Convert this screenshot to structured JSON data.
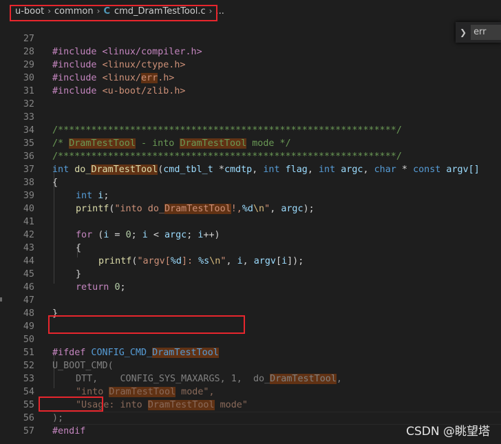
{
  "breadcrumb": {
    "items": [
      "u-boot",
      "common",
      "cmd_DramTestTool.c",
      "..."
    ],
    "file_icon": "C"
  },
  "find_widget": {
    "value": "err"
  },
  "watermark": "CSDN @眺望塔",
  "editor": {
    "line_numbers": [
      "27",
      "28",
      "29",
      "30",
      "31",
      "32",
      "33",
      "34",
      "35",
      "36",
      "37",
      "38",
      "39",
      "40",
      "41",
      "42",
      "43",
      "44",
      "45",
      "46",
      "47",
      "48",
      "49",
      "50",
      "51",
      "52",
      "53",
      "54",
      "55",
      "56",
      "57"
    ],
    "lines": {
      "l27": "#include <linux/compiler.h>",
      "l28a": "#include ",
      "l28b": "<linux/ctype.h>",
      "l29a": "#include ",
      "l29b": "<linux/",
      "l29c": "err",
      "l29d": ".h>",
      "l30a": "#include ",
      "l30b": "<u-boot/zlib.h>",
      "l33": "/*************************************************************/",
      "l34a": "/* ",
      "l34b": "DramTestTool",
      "l34c": " - into ",
      "l34d": "DramTestTool",
      "l34e": " mode */",
      "l35": "/*************************************************************/",
      "l36a": "int",
      "l36b": " do_",
      "l36c": "DramTestTool",
      "l36d": "(",
      "l36e": "cmd_tbl_t",
      "l36f": " *",
      "l36g": "cmdtp",
      "l36h": ", ",
      "l36i": "int",
      "l36j": " flag",
      "l36k": ", ",
      "l36l": "int",
      "l36m": " argc",
      "l36n": ", ",
      "l36o": "char",
      "l36p": " * ",
      "l36q": "const",
      "l36r": " argv[]",
      "l37": "{",
      "l38a": "int",
      "l38b": " i",
      "l38c": ";",
      "l39a": "printf",
      "l39b": "(",
      "l39c": "\"into do_",
      "l39d": "DramTestTool",
      "l39e": "!,",
      "l39f": "%d",
      "l39g": "\\n",
      "l39h": "\"",
      "l39i": ", ",
      "l39j": "argc",
      "l39k": ");",
      "l41a": "for",
      "l41b": " (",
      "l41c": "i",
      "l41d": " = ",
      "l41e": "0",
      "l41f": "; ",
      "l41g": "i",
      "l41h": " < ",
      "l41i": "argc",
      "l41j": "; ",
      "l41k": "i",
      "l41l": "++)",
      "l42": "{",
      "l43a": "printf",
      "l43b": "(",
      "l43c": "\"argv[",
      "l43d": "%d",
      "l43e": "]: ",
      "l43f": "%s",
      "l43g": "\\n",
      "l43h": "\"",
      "l43i": ", ",
      "l43j": "i",
      "l43k": ", ",
      "l43l": "argv",
      "l43m": "[",
      "l43n": "i",
      "l43o": "]);",
      "l44": "}",
      "l45a": "return",
      "l45b": " ",
      "l45c": "0",
      "l45d": ";",
      "l47": "}",
      "l50a": "#ifdef",
      "l50b": " CONFIG_CMD_",
      "l50c": "DramTestTool",
      "l51": "U_BOOT_CMD(",
      "l52a": "DTT,    CONFIG_SYS_MAXARGS, 1,  do_",
      "l52b": "DramTestTool",
      "l52c": ",",
      "l53a": "\"into ",
      "l53b": "DramTestTool",
      "l53c": " mode\",",
      "l54a": "\"Usage: into ",
      "l54b": "DramTestTool",
      "l54c": " mode\"",
      "l55": ");",
      "l56": "#endif"
    }
  }
}
